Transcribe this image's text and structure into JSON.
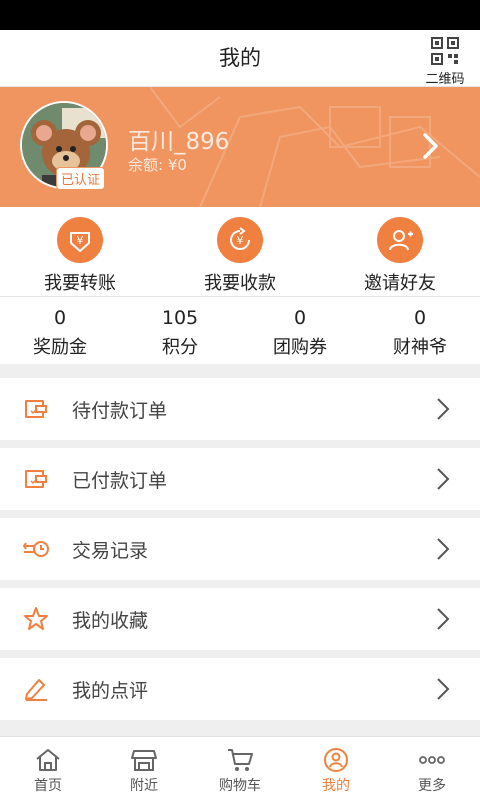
{
  "header": {
    "title": "我的",
    "qr_label": "二维码"
  },
  "profile": {
    "username": "百川_896",
    "balance": "余额: ¥0",
    "verified": "已认证"
  },
  "quick_actions": [
    {
      "label": "我要转账",
      "icon": "yuan-transfer-icon"
    },
    {
      "label": "我要收款",
      "icon": "yuan-receive-icon"
    },
    {
      "label": "邀请好友",
      "icon": "invite-friend-icon"
    }
  ],
  "stats": [
    {
      "value": "0",
      "label": "奖励金"
    },
    {
      "value": "105",
      "label": "积分"
    },
    {
      "value": "0",
      "label": "团购券"
    },
    {
      "value": "0",
      "label": "财神爷"
    }
  ],
  "menu": [
    {
      "label": "待付款订单",
      "icon": "wallet-icon"
    },
    {
      "label": "已付款订单",
      "icon": "wallet-icon"
    },
    {
      "label": "交易记录",
      "icon": "transaction-icon"
    },
    {
      "label": "我的收藏",
      "icon": "star-icon"
    },
    {
      "label": "我的点评",
      "icon": "edit-icon"
    }
  ],
  "tabs": [
    {
      "label": "首页",
      "icon": "home-icon"
    },
    {
      "label": "附近",
      "icon": "store-icon"
    },
    {
      "label": "购物车",
      "icon": "cart-icon"
    },
    {
      "label": "我的",
      "icon": "profile-icon",
      "active": true
    },
    {
      "label": "更多",
      "icon": "more-icon"
    }
  ],
  "colors": {
    "accent": "#f08040",
    "profile_bg": "#f0955f"
  }
}
